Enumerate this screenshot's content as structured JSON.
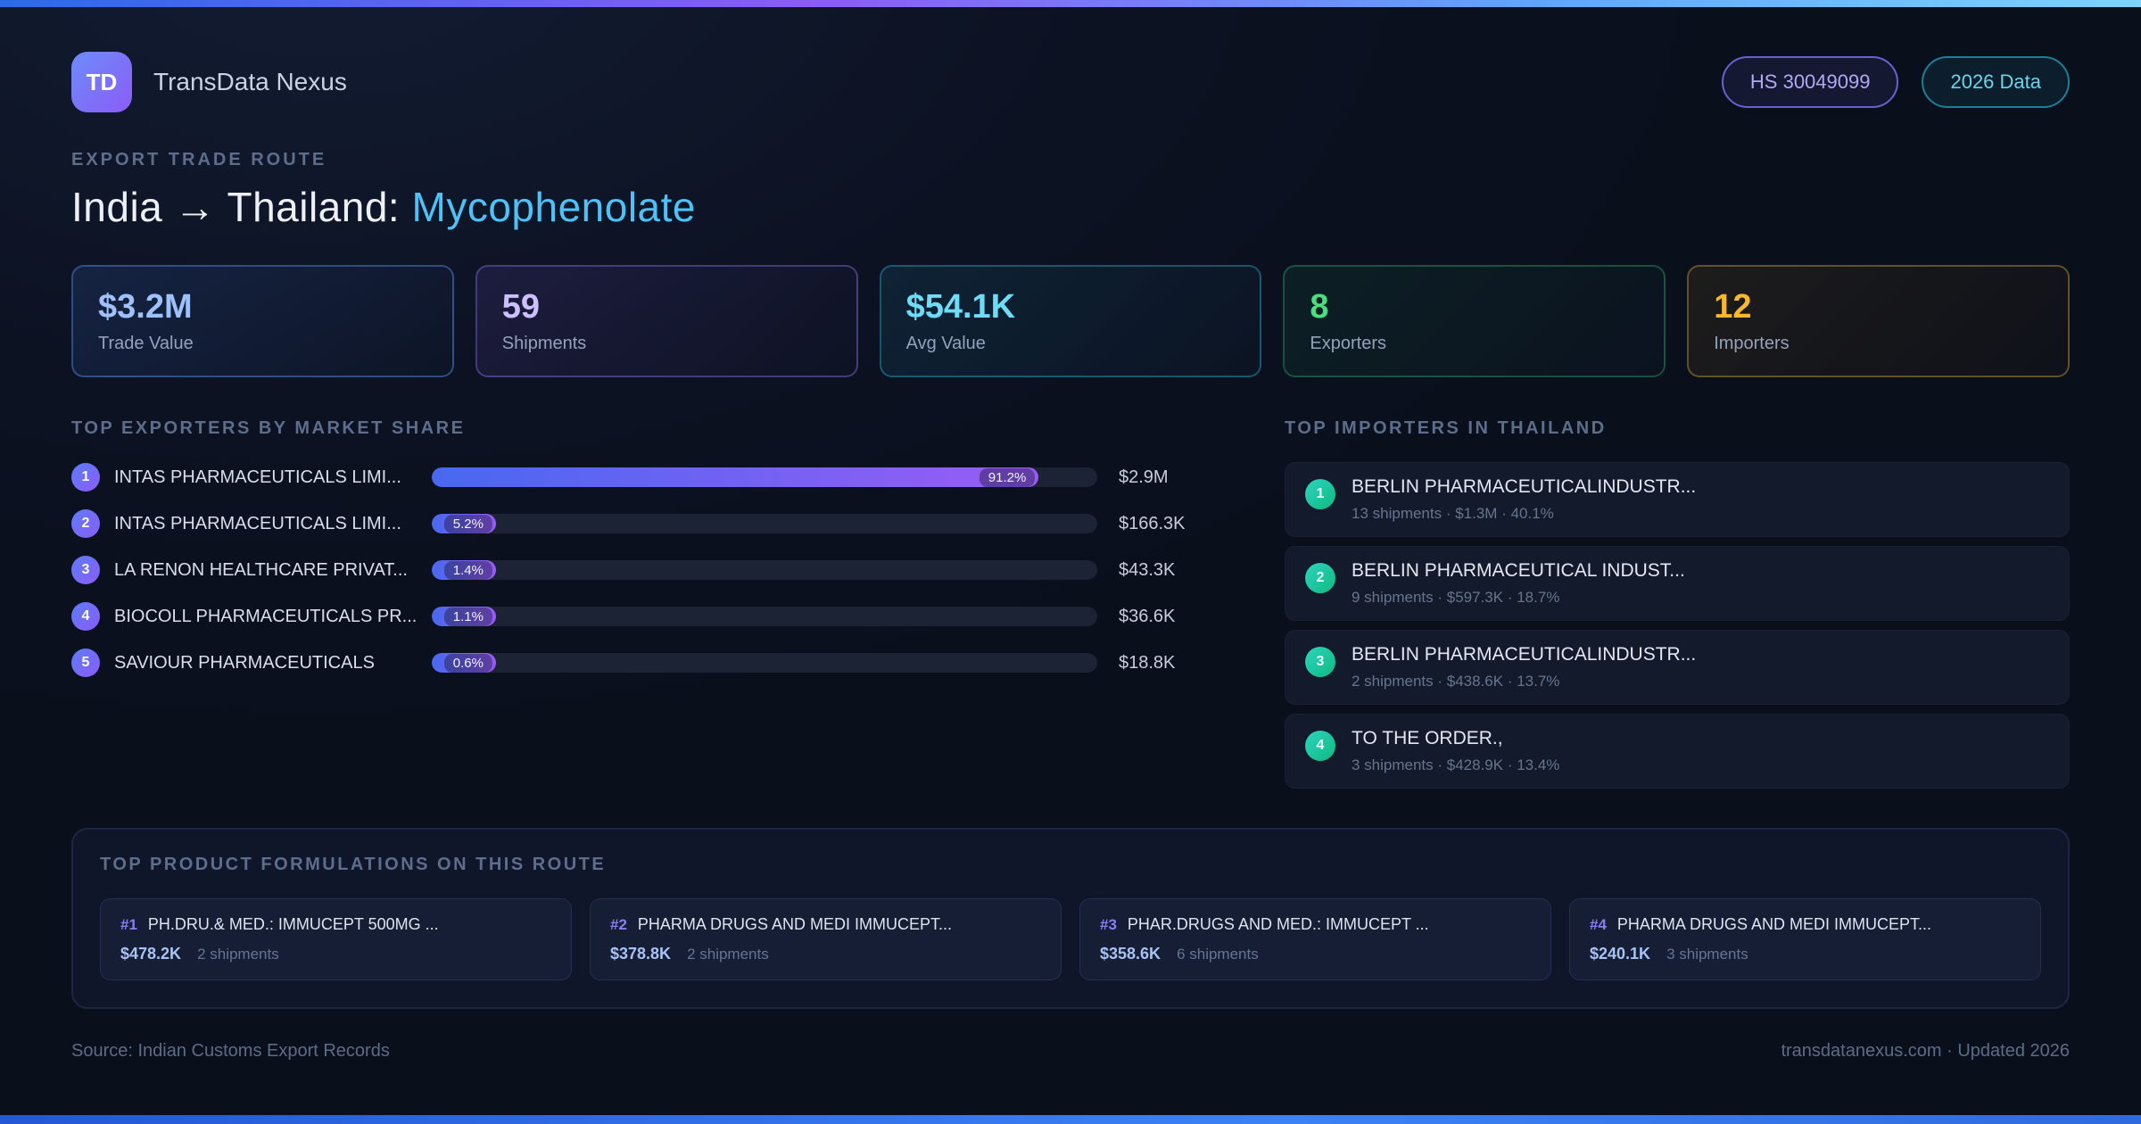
{
  "meta": {
    "brand": "TransData Nexus",
    "logo_initials": "TD",
    "hs_badge": "HS 30049099",
    "year_badge": "2026 Data",
    "eyebrow": "EXPORT TRADE ROUTE",
    "title_route": "India → Thailand: ",
    "title_product": "Mycophenolate"
  },
  "colors": {
    "accent_blue": "#4cc2f7",
    "accent_purple": "#8b5cf6",
    "accent_green": "#10b981",
    "accent_amber": "#f5b82e"
  },
  "stats": [
    {
      "value": "$3.2M",
      "label": "Trade Value"
    },
    {
      "value": "59",
      "label": "Shipments"
    },
    {
      "value": "$54.1K",
      "label": "Avg Value"
    },
    {
      "value": "8",
      "label": "Exporters"
    },
    {
      "value": "12",
      "label": "Importers"
    }
  ],
  "exporters": {
    "heading": "TOP EXPORTERS BY MARKET SHARE",
    "rows": [
      {
        "rank": "1",
        "name": "INTAS PHARMACEUTICALS LIMI...",
        "pct": "91.2%",
        "pct_value": 91.2,
        "value": "$2.9M"
      },
      {
        "rank": "2",
        "name": "INTAS PHARMACEUTICALS LIMI...",
        "pct": "5.2%",
        "pct_value": 5.2,
        "value": "$166.3K"
      },
      {
        "rank": "3",
        "name": "LA RENON HEALTHCARE PRIVAT...",
        "pct": "1.4%",
        "pct_value": 1.4,
        "value": "$43.3K"
      },
      {
        "rank": "4",
        "name": "BIOCOLL PHARMACEUTICALS PR...",
        "pct": "1.1%",
        "pct_value": 1.1,
        "value": "$36.6K"
      },
      {
        "rank": "5",
        "name": "SAVIOUR PHARMACEUTICALS",
        "pct": "0.6%",
        "pct_value": 0.6,
        "value": "$18.8K"
      }
    ]
  },
  "importers": {
    "heading": "TOP IMPORTERS IN THAILAND",
    "rows": [
      {
        "rank": "1",
        "name": "BERLIN PHARMACEUTICALINDUSTR...",
        "detail": "13 shipments · $1.3M · 40.1%"
      },
      {
        "rank": "2",
        "name": "BERLIN PHARMACEUTICAL INDUST...",
        "detail": "9 shipments · $597.3K · 18.7%"
      },
      {
        "rank": "3",
        "name": "BERLIN PHARMACEUTICALINDUSTR...",
        "detail": "2 shipments · $438.6K · 13.7%"
      },
      {
        "rank": "4",
        "name": "TO THE ORDER.,",
        "detail": "3 shipments · $428.9K · 13.4%"
      }
    ]
  },
  "products": {
    "heading": "TOP PRODUCT FORMULATIONS ON THIS ROUTE",
    "cards": [
      {
        "rank": "#1",
        "name": "PH.DRU.& MED.: IMMUCEPT 500MG ...",
        "value": "$478.2K",
        "shipments": "2 shipments"
      },
      {
        "rank": "#2",
        "name": "PHARMA DRUGS AND MEDI IMMUCEPT...",
        "value": "$378.8K",
        "shipments": "2 shipments"
      },
      {
        "rank": "#3",
        "name": "PHAR.DRUGS AND MED.: IMMUCEPT ...",
        "value": "$358.6K",
        "shipments": "6 shipments"
      },
      {
        "rank": "#4",
        "name": "PHARMA DRUGS AND MEDI IMMUCEPT...",
        "value": "$240.1K",
        "shipments": "3 shipments"
      }
    ]
  },
  "footer": {
    "source": "Source: Indian Customs Export Records",
    "site": "transdatanexus.com · Updated 2026"
  },
  "chart_data": {
    "type": "bar",
    "title": "TOP EXPORTERS BY MARKET SHARE",
    "categories": [
      "INTAS PHARMACEUTICALS LIMI...",
      "INTAS PHARMACEUTICALS LIMI...",
      "LA RENON HEALTHCARE PRIVAT...",
      "BIOCOLL PHARMACEUTICALS PR...",
      "SAVIOUR PHARMACEUTICALS"
    ],
    "values": [
      91.2,
      5.2,
      1.4,
      1.1,
      0.6
    ],
    "value_labels": [
      "$2.9M",
      "$166.3K",
      "$43.3K",
      "$36.6K",
      "$18.8K"
    ],
    "xlabel": "",
    "ylabel": "Market share (%)",
    "xlim": [
      0,
      100
    ],
    "orientation": "horizontal",
    "grid": false
  }
}
